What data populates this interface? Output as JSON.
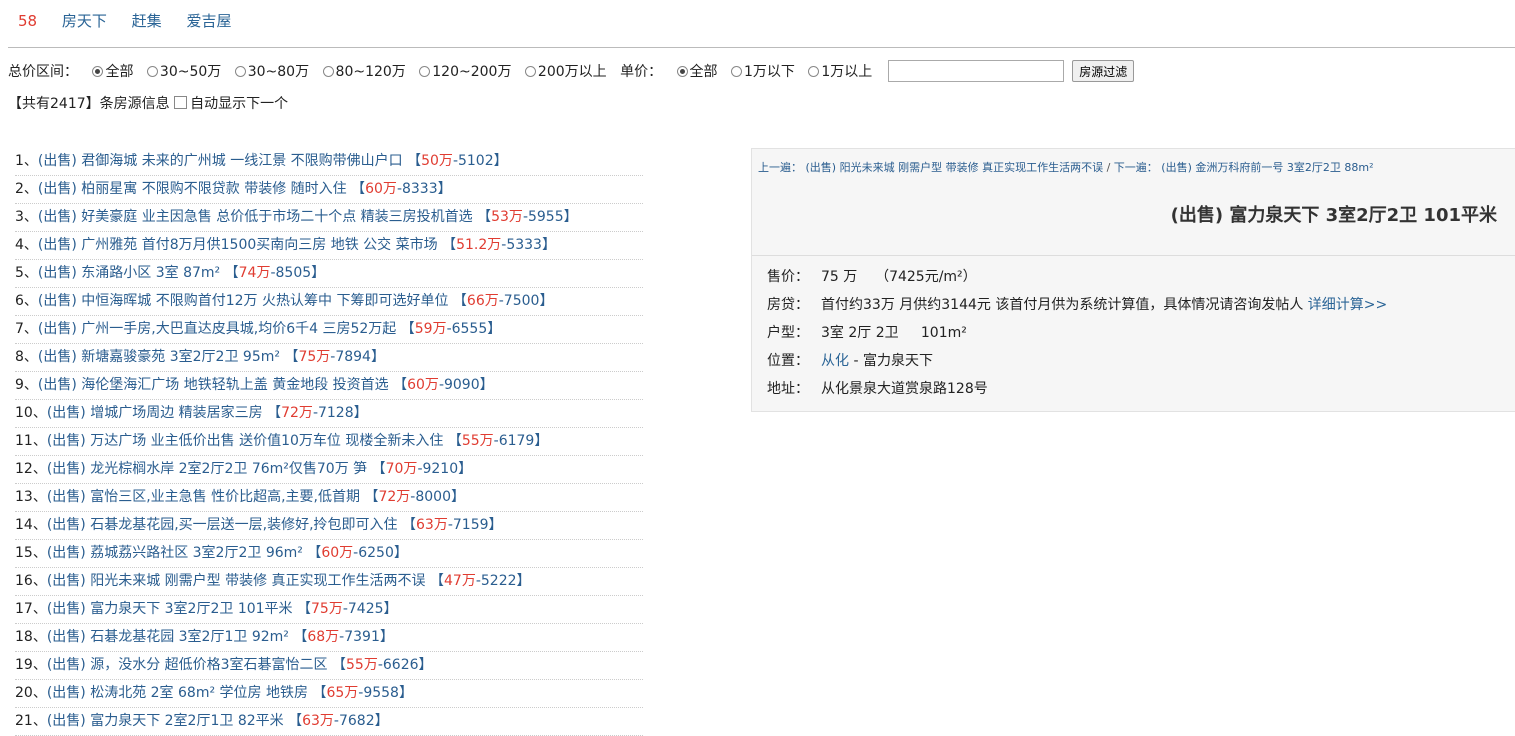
{
  "nav_links": [
    "58",
    "房天下",
    "赶集",
    "爱吉屋"
  ],
  "filter": {
    "total_label": "总价区间：",
    "total_options": [
      "全部",
      "30~50万",
      "30~80万",
      "80~120万",
      "120~200万",
      "200万以上"
    ],
    "unit_label": "单价：",
    "unit_options": [
      "全部",
      "1万以下",
      "1万以上"
    ],
    "search_value": "",
    "filter_button": "房源过滤"
  },
  "count": {
    "prefix": "【共有",
    "number": "2417",
    "suffix": "】条房源信息",
    "auto_label": "自动显示下一个"
  },
  "listings": [
    {
      "n": "1、",
      "title": "(出售) 君御海城 未来的广州城 一线江景 不限购带佛山户口",
      "price": "50万",
      "unit": "-5102"
    },
    {
      "n": "2、",
      "title": "(出售) 柏丽星寓 不限购不限贷款 带装修 随时入住",
      "price": "60万",
      "unit": "-8333"
    },
    {
      "n": "3、",
      "title": "(出售) 好美豪庭 业主因急售 总价低于市场二十个点 精装三房投机首选",
      "price": "53万",
      "unit": "-5955"
    },
    {
      "n": "4、",
      "title": "(出售) 广州雅苑 首付8万月供1500买南向三房 地铁 公交 菜市场",
      "price": "51.2万",
      "unit": "-5333"
    },
    {
      "n": "5、",
      "title": "(出售) 东涌路小区 3室 87m²",
      "price": "74万",
      "unit": "-8505"
    },
    {
      "n": "6、",
      "title": "(出售) 中恒海晖城 不限购首付12万 火热认筹中 下筹即可选好单位",
      "price": "66万",
      "unit": "-7500"
    },
    {
      "n": "7、",
      "title": "(出售) 广州一手房,大巴直达皮具城,均价6千4 三房52万起",
      "price": "59万",
      "unit": "-6555"
    },
    {
      "n": "8、",
      "title": "(出售) 新塘嘉骏豪苑 3室2厅2卫 95m²",
      "price": "75万",
      "unit": "-7894"
    },
    {
      "n": "9、",
      "title": "(出售) 海伦堡海汇广场 地铁轻轨上盖 黄金地段 投资首选",
      "price": "60万",
      "unit": "-9090"
    },
    {
      "n": "10、",
      "title": "(出售) 增城广场周边 精装居家三房",
      "price": "72万",
      "unit": "-7128"
    },
    {
      "n": "11、",
      "title": "(出售) 万达广场 业主低价出售 送价值10万车位 现楼全新未入住",
      "price": "55万",
      "unit": "-6179"
    },
    {
      "n": "12、",
      "title": "(出售) 龙光棕榈水岸 2室2厅2卫 76m²仅售70万 笋",
      "price": "70万",
      "unit": "-9210"
    },
    {
      "n": "13、",
      "title": "(出售) 富怡三区,业主急售 性价比超高,主要,低首期",
      "price": "72万",
      "unit": "-8000"
    },
    {
      "n": "14、",
      "title": "(出售) 石碁龙基花园,买一层送一层,装修好,拎包即可入住",
      "price": "63万",
      "unit": "-7159"
    },
    {
      "n": "15、",
      "title": "(出售) 荔城荔兴路社区 3室2厅2卫 96m²",
      "price": "60万",
      "unit": "-6250"
    },
    {
      "n": "16、",
      "title": "(出售) 阳光未来城 刚需户型 带装修 真正实现工作生活两不误",
      "price": "47万",
      "unit": "-5222"
    },
    {
      "n": "17、",
      "title": "(出售) 富力泉天下 3室2厅2卫 101平米",
      "price": "75万",
      "unit": "-7425"
    },
    {
      "n": "18、",
      "title": "(出售) 石碁龙基花园 3室2厅1卫 92m²",
      "price": "68万",
      "unit": "-7391"
    },
    {
      "n": "19、",
      "title": "(出售) 源，没水分 超低价格3室石碁富怡二区",
      "price": "55万",
      "unit": "-6626"
    },
    {
      "n": "20、",
      "title": "(出售) 松涛北苑 2室 68m² 学位房 地铁房",
      "price": "65万",
      "unit": "-9558"
    },
    {
      "n": "21、",
      "title": "(出售) 富力泉天下 2室2厅1卫 82平米",
      "price": "63万",
      "unit": "-7682"
    }
  ],
  "detail": {
    "prev_label": "上一遍：",
    "prev_title": "(出售) 阳光未来城 刚需户型 带装修 真正实现工作生活两不误",
    "separator": "/",
    "next_label": "下一遍：",
    "next_title": "(出售) 金洲万科府前一号 3室2厅2卫 88m²",
    "title": "(出售) 富力泉天下 3室2厅2卫 101平米",
    "price_label": "售价：",
    "price_value": "75 万",
    "price_unit": "（7425元/m²）",
    "loan_label": "房贷：",
    "loan_text": "首付约33万 月供约3144元 该首付月供为系统计算值，具体情况请咨询发帖人",
    "loan_link": "详细计算>>",
    "layout_label": "户型：",
    "layout_rooms": "3室 2厅 2卫",
    "layout_area": "101m²",
    "location_label": "位置：",
    "location_district": "从化",
    "location_rest": " - 富力泉天下",
    "address_label": "地址：",
    "address_value": "从化景泉大道赏泉路128号"
  }
}
